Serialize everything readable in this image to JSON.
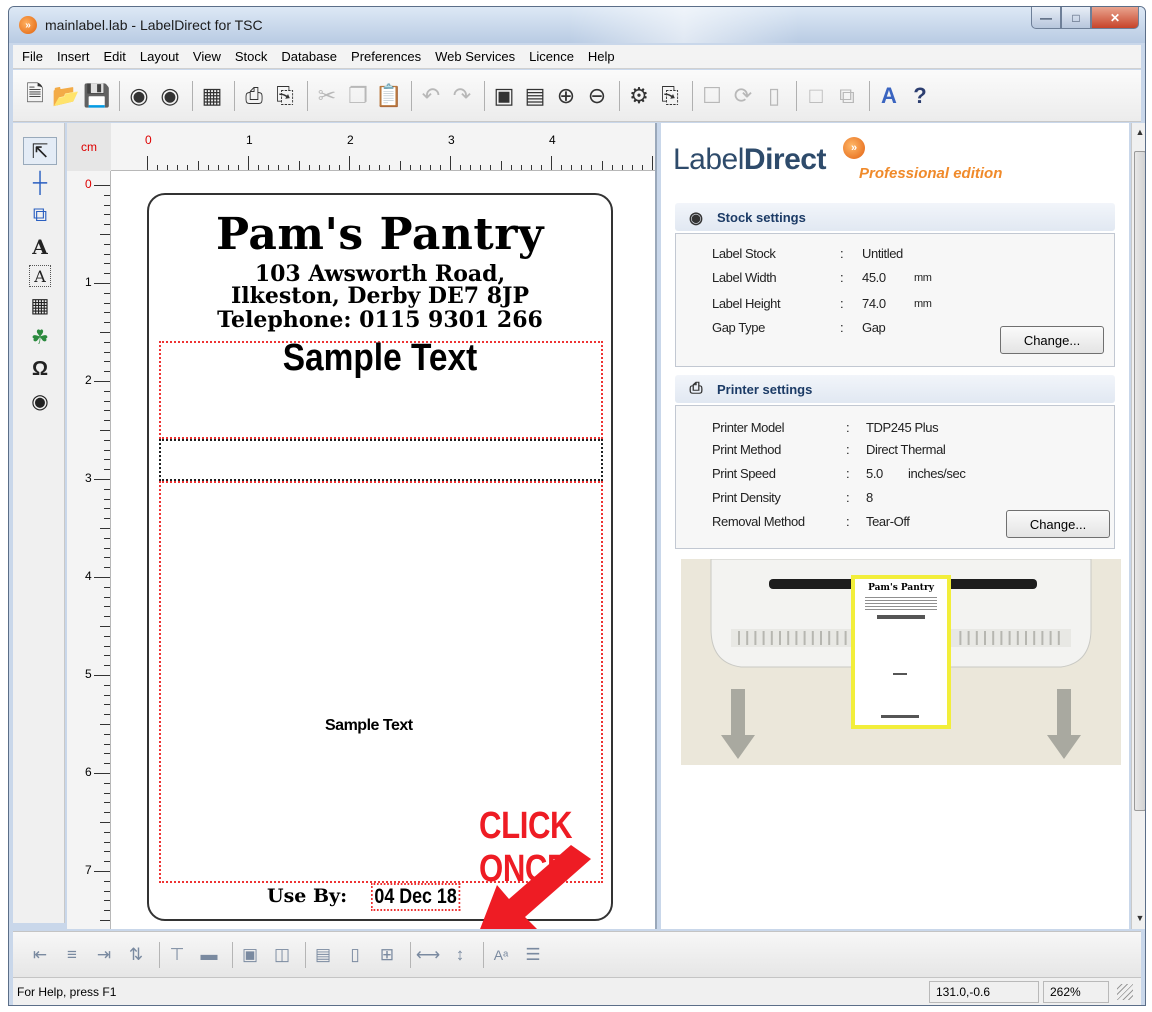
{
  "window": {
    "title": "mainlabel.lab - LabelDirect for TSC",
    "controls": [
      "minimize",
      "maximize",
      "close"
    ]
  },
  "menubar": {
    "items": [
      "File",
      "Insert",
      "Edit",
      "Layout",
      "View",
      "Stock",
      "Database",
      "Preferences",
      "Web Services",
      "Licence",
      "Help"
    ]
  },
  "toolbar": {
    "icons": [
      "new-icon",
      "open-icon",
      "save-icon",
      "stock-icon",
      "stock-alt-icon",
      "database-icon",
      "print-icon",
      "print-preview-icon",
      "cut-icon",
      "copy-icon",
      "paste-icon",
      "undo-icon",
      "redo-icon",
      "label-view-icon",
      "data-view-icon",
      "zoom-in-icon",
      "zoom-out-icon",
      "stock-settings-icon",
      "printer-setup-icon",
      "lock-icon",
      "rotate-icon",
      "page-icon",
      "window-icon",
      "windows-icon",
      "font-icon",
      "help-icon"
    ]
  },
  "left_tools": [
    "pointer-icon",
    "line-icon",
    "shape-icon",
    "text-icon",
    "text-box-icon",
    "barcode-icon",
    "picture-icon",
    "symbol-icon",
    "camera-icon"
  ],
  "ruler": {
    "unit": "cm",
    "top_marks": [
      "0",
      "1",
      "2",
      "3",
      "4"
    ],
    "left_marks": [
      "0",
      "1",
      "2",
      "3",
      "4",
      "5",
      "6",
      "7"
    ]
  },
  "label": {
    "business_name": "Pam's Pantry",
    "address_line1": "103 Awsworth Road,",
    "address_line2": "Ilkeston, Derby DE7 8JP",
    "telephone": "Telephone: 0115 9301 266",
    "sample_text_large": "Sample Text",
    "sample_text_small": "Sample Text",
    "use_by_label": "Use By:",
    "use_by_date": "04 Dec 18"
  },
  "annotation": {
    "callout_text": "CLICK ONCE",
    "color": "#ee1c24"
  },
  "panel": {
    "logo_text": "Label",
    "logo_bold": "Direct",
    "edition": "Professional edition",
    "stock": {
      "heading": "Stock settings",
      "rows": [
        {
          "key": "Label Stock",
          "sep": ":",
          "value": "Untitled",
          "unit": ""
        },
        {
          "key": "Label Width",
          "sep": ":",
          "value": "45.0",
          "unit": "mm"
        },
        {
          "key": "Label Height",
          "sep": ":",
          "value": "74.0",
          "unit": "mm"
        },
        {
          "key": "Gap Type",
          "sep": ":",
          "value": "Gap",
          "unit": ""
        }
      ],
      "button": "Change..."
    },
    "printer": {
      "heading": "Printer settings",
      "rows": [
        {
          "key": "Printer Model",
          "sep": ":",
          "value": "TDP245 Plus",
          "unit": ""
        },
        {
          "key": "Print Method",
          "sep": ":",
          "value": "Direct Thermal",
          "unit": ""
        },
        {
          "key": "Print Speed",
          "sep": ":",
          "value": "5.0",
          "unit": "inches/sec"
        },
        {
          "key": "Print Density",
          "sep": ":",
          "value": "8",
          "unit": ""
        },
        {
          "key": "Removal Method",
          "sep": ":",
          "value": "Tear-Off",
          "unit": ""
        }
      ],
      "button": "Change..."
    },
    "preview_label_title": "Pam's Pantry"
  },
  "align_tools": [
    "align-left-icon",
    "align-center-icon",
    "align-right-icon",
    "align-distribute-icon",
    "align-top-icon",
    "align-middle-icon",
    "align-bottom-icon",
    "center-horizontal-icon",
    "center-vertical-icon",
    "same-width-icon",
    "same-height-icon",
    "same-size-icon",
    "space-horizontal-icon",
    "space-vertical-icon",
    "font-size-icon",
    "lines-icon"
  ],
  "statusbar": {
    "help": "For Help, press F1",
    "coords": "131.0,-0.6",
    "zoom": "262%"
  }
}
